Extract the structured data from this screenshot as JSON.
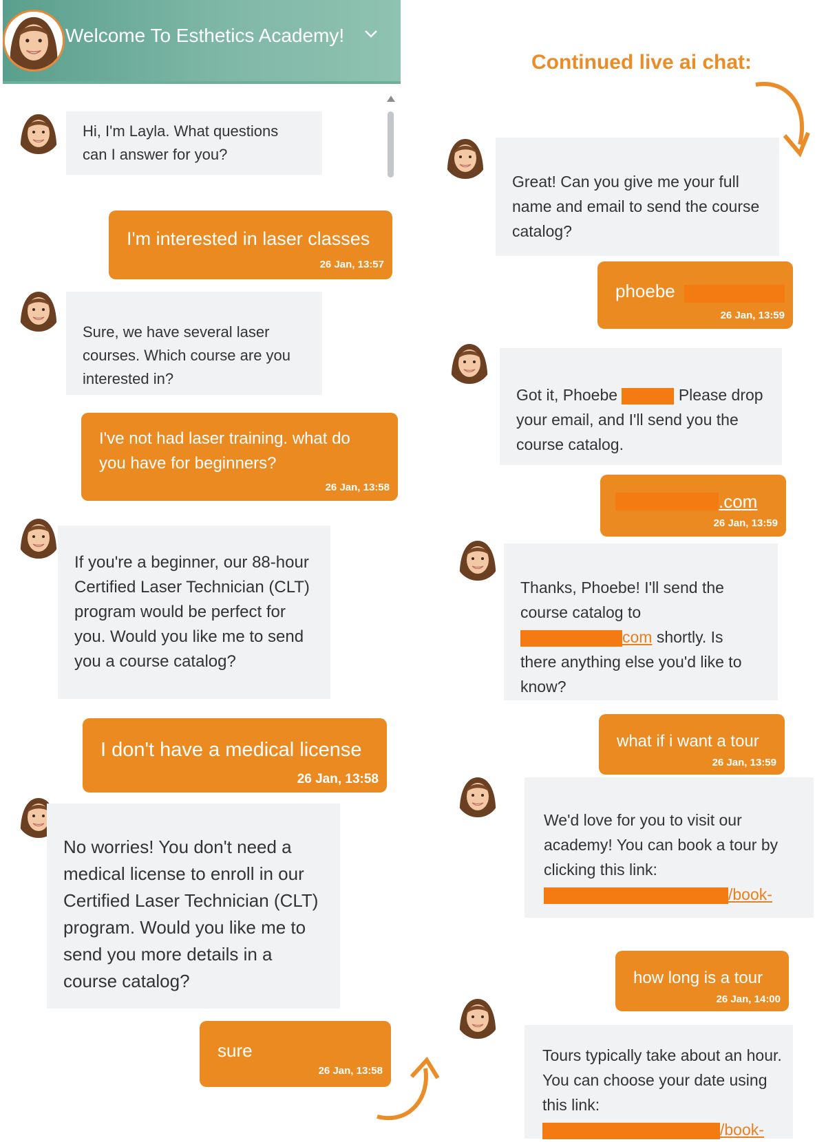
{
  "header": {
    "title": "Welcome To Esthetics Academy!"
  },
  "caption": "Continued live ai chat:",
  "left_messages": [
    {
      "role": "bot",
      "text": "Hi, I'm Layla. What questions can I answer for you?"
    },
    {
      "role": "user",
      "text": "I'm interested in laser classes",
      "time": "26 Jan, 13:57"
    },
    {
      "role": "bot",
      "text": "Sure, we have several laser courses. Which course are you interested in?"
    },
    {
      "role": "user",
      "lines": [
        "I've not had laser training. what do",
        "you have for beginners?"
      ],
      "time": "26 Jan, 13:58"
    },
    {
      "role": "bot",
      "text": "If you're a beginner, our 88-hour Certified Laser Technician (CLT) program would be perfect for you. Would you like me to send you a course catalog?"
    },
    {
      "role": "user",
      "text": "I don't have a medical license",
      "time": "26 Jan, 13:58"
    },
    {
      "role": "bot",
      "text": "No worries! You don't need a medical license to enroll in our Certified Laser Technician (CLT) program. Would you like me to send you more details in a course catalog?"
    },
    {
      "role": "user",
      "text": "sure",
      "time": "26 Jan, 13:58"
    }
  ],
  "right_messages": [
    {
      "role": "bot",
      "text": "Great! Can you give me your full name and email to send the course catalog?"
    },
    {
      "role": "user",
      "text": "phoebe",
      "time": "26 Jan, 13:59"
    },
    {
      "role": "bot",
      "before": "Got it, Phoebe",
      "after": "Please drop your email, and I'll send you the course catalog."
    },
    {
      "role": "user",
      "text": ".com",
      "time": "26 Jan, 13:59"
    },
    {
      "role": "bot",
      "before": "Thanks, Phoebe! I'll send the course catalog to",
      "link": "com",
      "after": "shortly. Is there anything else you'd like to know?"
    },
    {
      "role": "user",
      "text": "what if i want a tour",
      "time": "26 Jan, 13:59"
    },
    {
      "role": "bot",
      "text": "We'd love for you to visit our academy! You can book a tour by clicking this link:",
      "link": "/book-"
    },
    {
      "role": "user",
      "text": "how long is a tour",
      "time": "26 Jan, 14:00"
    },
    {
      "role": "bot",
      "text": "Tours typically take about an hour. You can choose your date using this link:",
      "link": "/book-"
    }
  ]
}
